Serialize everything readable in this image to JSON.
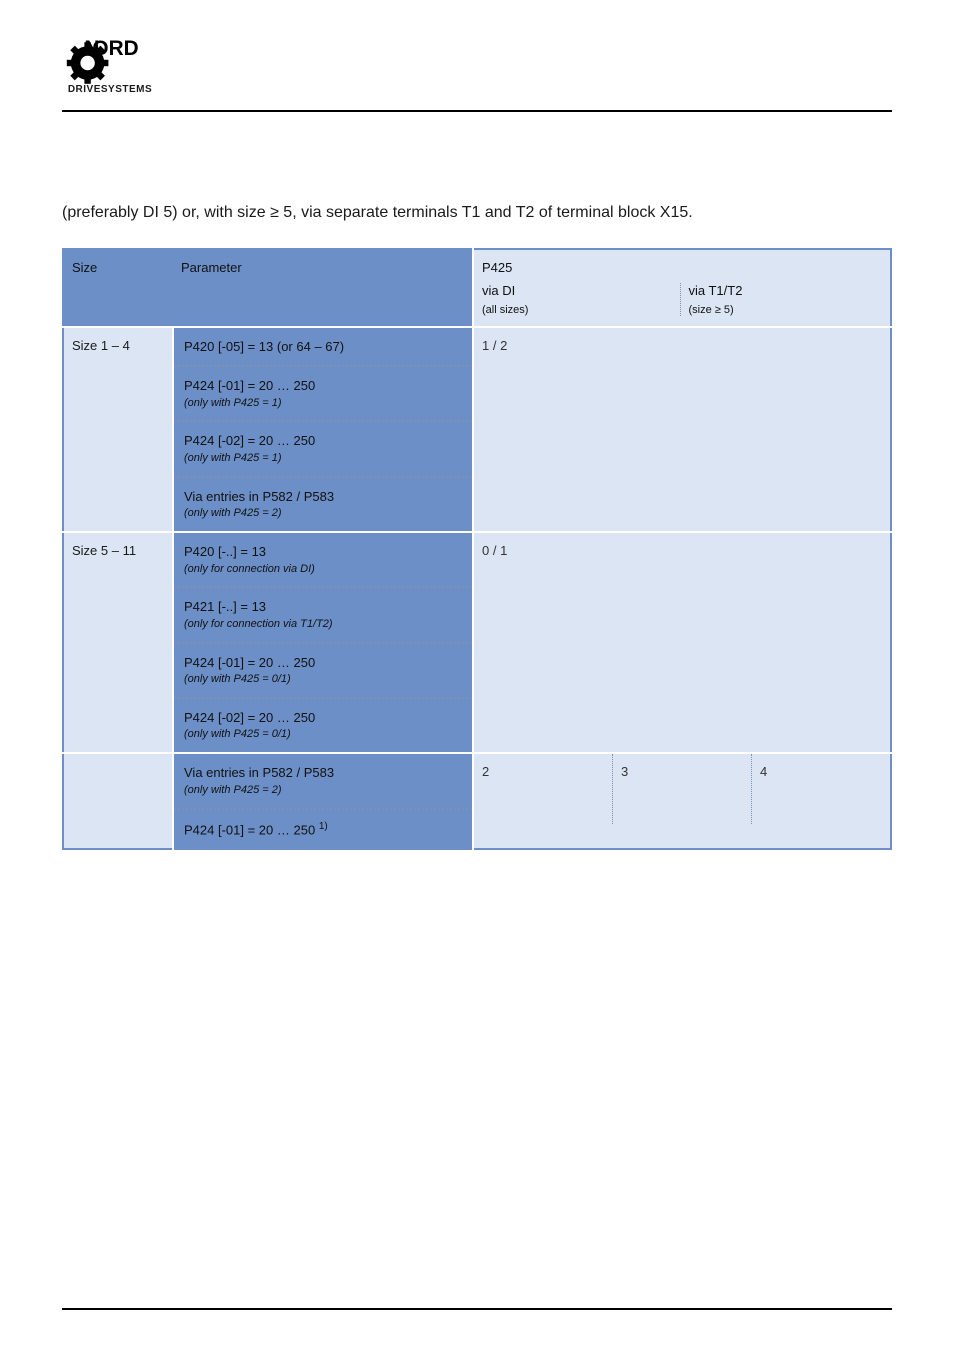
{
  "logo_sub": "DRIVESYSTEMS",
  "intro": "(preferably DI 5) or, with size ≥ 5, via separate terminals T1 and T2 of terminal block X15.",
  "table": {
    "headers": {
      "size": "Size",
      "parameter": "Parameter",
      "p425": "P425",
      "via_di": "via DI",
      "via_t": "via T1/T2"
    },
    "sub_headers": {
      "sizes_all": "(all sizes)",
      "sizes_ge5": "(size ≥ 5)"
    },
    "groups": [
      {
        "size": "Size 1 – 4",
        "params": [
          {
            "main": "P420 [-05] = 13 (or 64 – 67)",
            "note": ""
          },
          {
            "main": "P424 [-01] = 20 … 250",
            "note": "(only with P425 = 1)"
          },
          {
            "main": "P424 [-02] = 20 … 250",
            "note": "(only with P425 = 1)"
          },
          {
            "main": "Via entries in P582 / P583",
            "note": "(only with P425 = 2)"
          }
        ],
        "right": {
          "split": false,
          "cells": [
            "1 / 2"
          ]
        }
      },
      {
        "size": "Size 5 – 11",
        "params": [
          {
            "main": "P420 [-..] = 13",
            "note": "(only for connection via DI)"
          },
          {
            "main": "P421 [-..] = 13",
            "note": "(only for connection via T1/T2)"
          },
          {
            "main": "P424 [-01] = 20 … 250",
            "note": "(only with P425 = 0/1)"
          },
          {
            "main": "P424 [-02] = 20 … 250",
            "note": "(only with P425 = 0/1)"
          }
        ],
        "right": {
          "split": false,
          "cells": [
            "0 / 1"
          ]
        }
      },
      {
        "size": "",
        "params": [
          {
            "main": "Via entries in P582 / P583",
            "note": "(only with P425 = 2)"
          },
          {
            "main": "P424 [-01] = 20 … 250",
            "note": "1)"
          }
        ],
        "right": {
          "split": true,
          "cells": [
            "2",
            "3",
            "4"
          ]
        }
      }
    ]
  }
}
